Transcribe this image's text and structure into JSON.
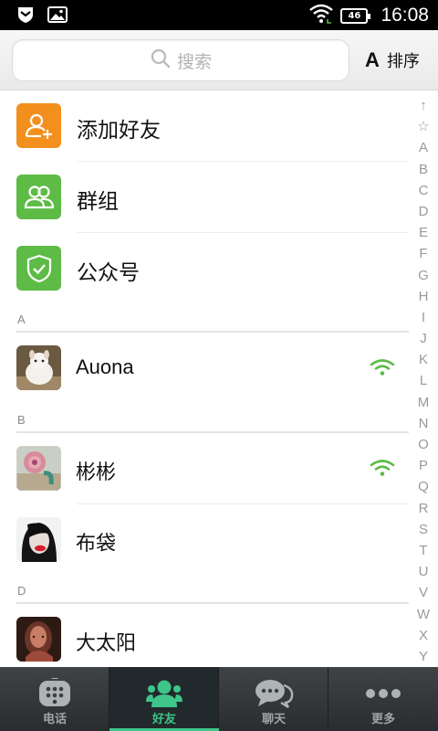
{
  "status_bar": {
    "time": "16:08",
    "battery": "46",
    "icons": [
      "shield-notification-icon",
      "image-notification-icon",
      "wifi-icon",
      "battery-icon"
    ]
  },
  "header": {
    "search_placeholder": "搜索",
    "sort_letter": "A",
    "sort_label": "排序"
  },
  "quick_entries": [
    {
      "label": "添加好友",
      "icon": "add-friend-icon",
      "color": "#f38f1c"
    },
    {
      "label": "群组",
      "icon": "group-icon",
      "color": "#5dbb46"
    },
    {
      "label": "公众号",
      "icon": "public-account-icon",
      "color": "#5dbb46"
    }
  ],
  "sections": [
    {
      "letter": "A",
      "contacts": [
        {
          "name": "Auona",
          "online": true
        }
      ]
    },
    {
      "letter": "B",
      "contacts": [
        {
          "name": "彬彬",
          "online": true
        },
        {
          "name": "布袋",
          "online": false
        }
      ]
    },
    {
      "letter": "D",
      "contacts": [
        {
          "name": "大太阳",
          "online": false
        }
      ]
    }
  ],
  "index_letters": [
    "↑",
    "☆",
    "A",
    "B",
    "C",
    "D",
    "E",
    "F",
    "G",
    "H",
    "I",
    "J",
    "K",
    "L",
    "M",
    "N",
    "O",
    "P",
    "Q",
    "R",
    "S",
    "T",
    "U",
    "V",
    "W",
    "X",
    "Y"
  ],
  "tabs": [
    {
      "label": "电话",
      "icon": "dialpad-icon",
      "active": false
    },
    {
      "label": "好友",
      "icon": "friends-icon",
      "active": true
    },
    {
      "label": "聊天",
      "icon": "chat-icon",
      "active": false
    },
    {
      "label": "更多",
      "icon": "more-icon",
      "active": false
    }
  ],
  "colors": {
    "accent_green": "#3ec58a",
    "online_green": "#5dbb46",
    "orange": "#f38f1c"
  }
}
